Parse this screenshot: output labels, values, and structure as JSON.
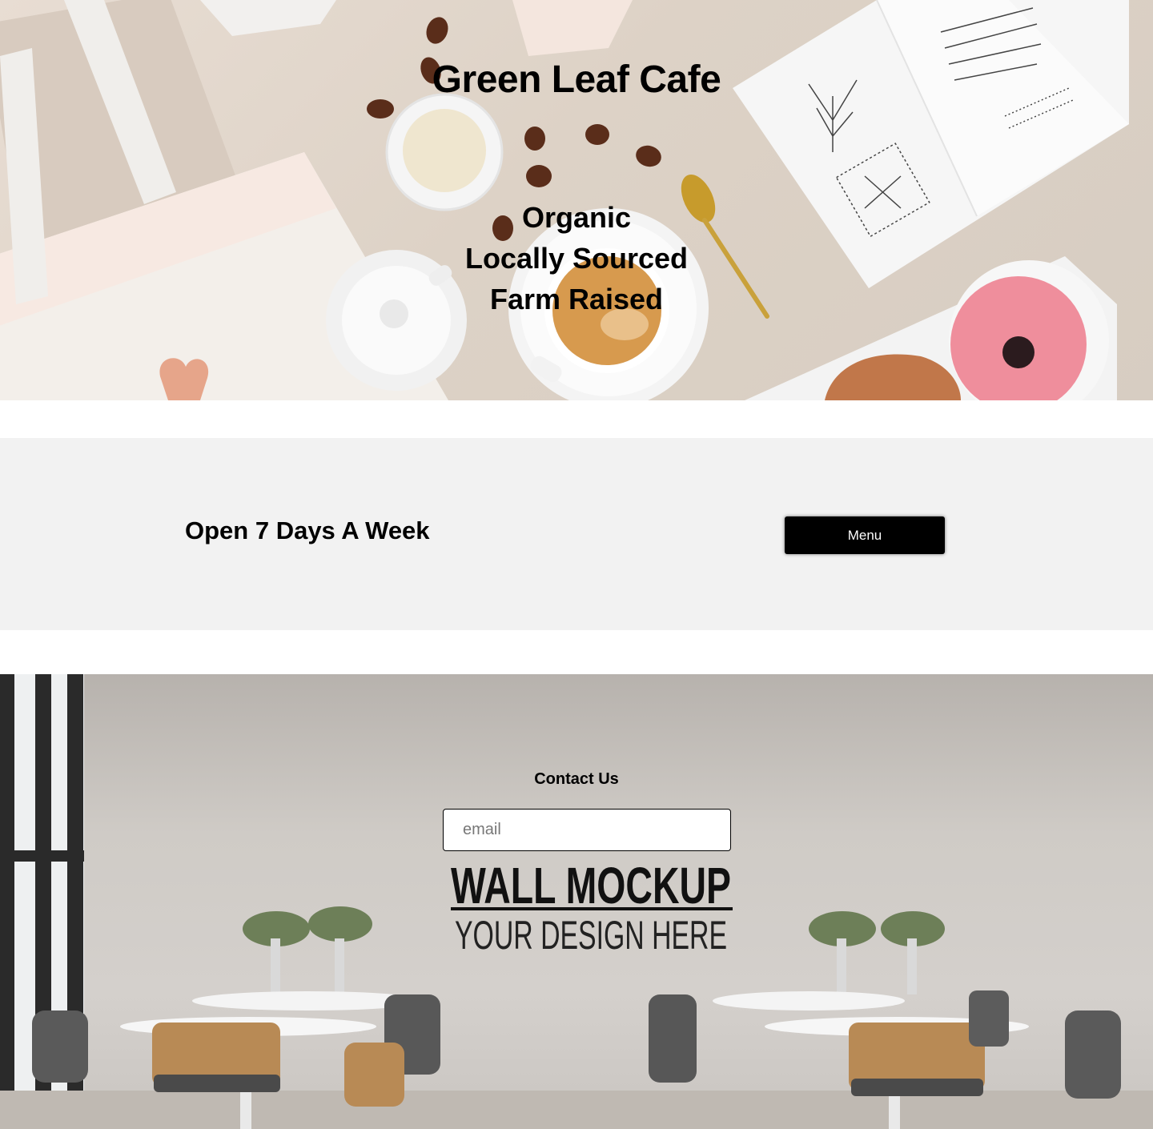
{
  "hero": {
    "title": "Green Leaf Cafe",
    "taglines": [
      "Organic",
      "Locally Sourced",
      "Farm Raised"
    ]
  },
  "info": {
    "hours_text": "Open 7 Days A Week",
    "menu_button_label": "Menu"
  },
  "contact": {
    "title": "Contact Us",
    "email_placeholder": "email",
    "wall_sign": {
      "line1": "WALL MOCKUP",
      "line2": "YOUR DESIGN HERE"
    }
  },
  "colors": {
    "button_bg": "#000000",
    "button_text": "#ffffff",
    "band_bg": "#f2f2f2"
  }
}
